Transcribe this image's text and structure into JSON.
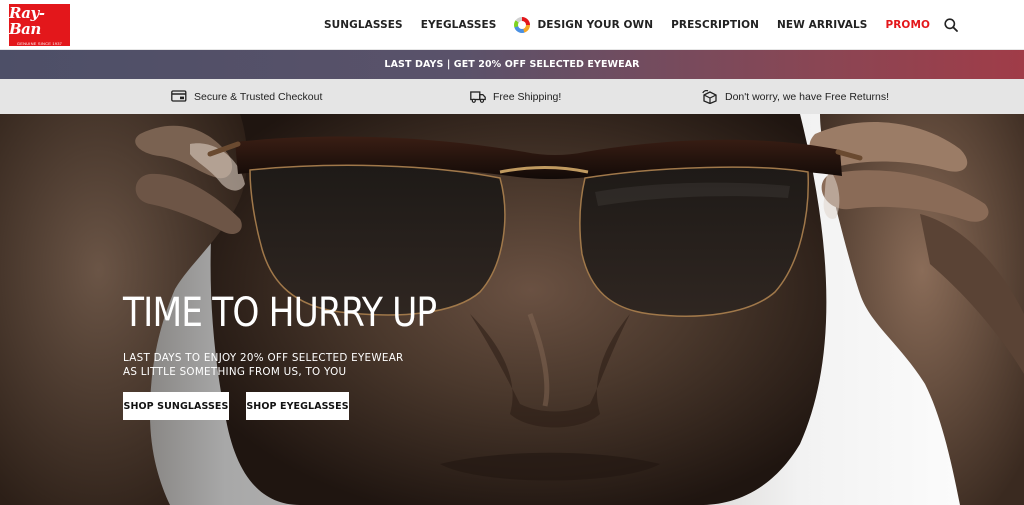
{
  "brand": {
    "logo_text": "Ray-Ban",
    "logo_tagline": "GENUINE SINCE 1937",
    "accent_color": "#e3171b"
  },
  "nav": {
    "items": [
      {
        "label": "SUNGLASSES"
      },
      {
        "label": "EYEGLASSES"
      },
      {
        "label": "DESIGN YOUR OWN",
        "icon": "color-wheel-icon"
      },
      {
        "label": "PRESCRIPTION"
      },
      {
        "label": "NEW ARRIVALS"
      },
      {
        "label": "PROMO",
        "color": "#e3171b"
      }
    ],
    "search_icon": "search-icon"
  },
  "promo_bar": {
    "text": "LAST DAYS | GET 20% OFF SELECTED EYEWEAR"
  },
  "benefits": [
    {
      "icon": "credit-card-icon",
      "text": "Secure & Trusted Checkout"
    },
    {
      "icon": "truck-icon",
      "text": "Free Shipping!"
    },
    {
      "icon": "return-box-icon",
      "text": "Don't worry, we have Free Returns!"
    }
  ],
  "hero": {
    "title": "TIME TO HURRY UP",
    "subtitle_line1": "LAST DAYS TO ENJOY 20% OFF SELECTED EYEWEAR",
    "subtitle_line2": "AS LITTLE SOMETHING FROM US, TO YOU",
    "buttons": [
      {
        "label": "SHOP SUNGLASSES"
      },
      {
        "label": "SHOP EYEGLASSES"
      }
    ]
  }
}
